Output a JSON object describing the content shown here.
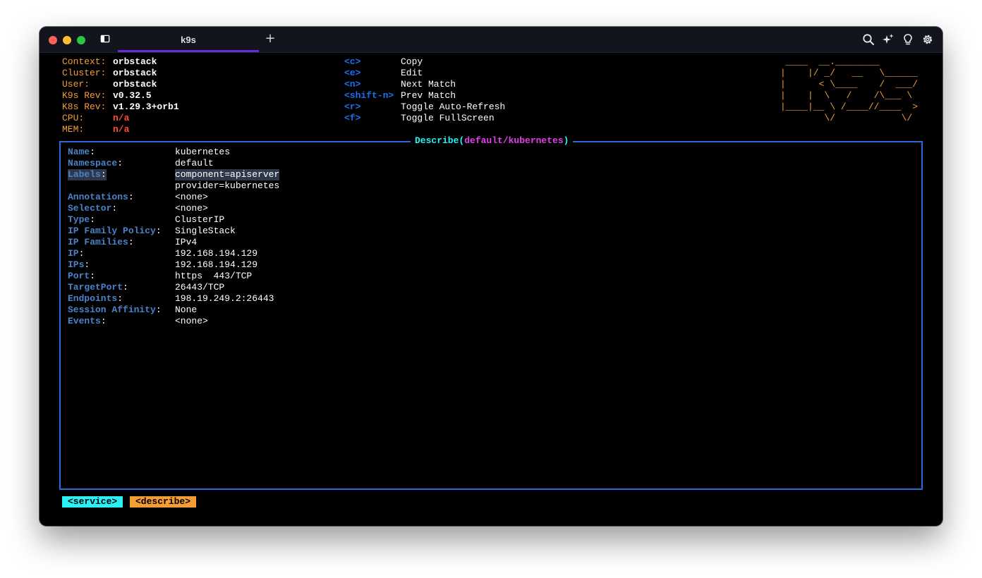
{
  "window": {
    "tab_title": "k9s",
    "new_tab_label": "+",
    "icons": [
      "sidebar-icon",
      "search-icon",
      "sparkle-icon",
      "lightbulb-icon",
      "gear-icon"
    ]
  },
  "header": {
    "info": [
      {
        "label": "Context:",
        "value": "orbstack"
      },
      {
        "label": "Cluster:",
        "value": "orbstack"
      },
      {
        "label": "User:",
        "value": "orbstack"
      },
      {
        "label": "K9s Rev:",
        "value": "v0.32.5"
      },
      {
        "label": "K8s Rev:",
        "value": "v1.29.3+orb1"
      },
      {
        "label": "CPU:",
        "value": "n/a"
      },
      {
        "label": "MEM:",
        "value": "n/a"
      }
    ],
    "shortcuts": [
      {
        "key": "<c>",
        "action": "Copy"
      },
      {
        "key": "<e>",
        "action": "Edit"
      },
      {
        "key": "<n>",
        "action": "Next Match"
      },
      {
        "key": "<shift-n>",
        "action": "Prev Match"
      },
      {
        "key": "<r>",
        "action": "Toggle Auto-Refresh"
      },
      {
        "key": "<f>",
        "action": "Toggle FullScreen"
      }
    ],
    "logo": " ____  __.________       \n|    |/ _/   __   \\______ \n|      < \\____    /  ___/ \n|    |  \\   /    /\\___ \\  \n|____|__ \\ /____//____  > \n        \\/            \\/  "
  },
  "describe": {
    "title_prefix": "Describe(",
    "title_resource": "default/kubernetes",
    "title_suffix": ")",
    "fields": [
      {
        "key": "Name",
        "value": "kubernetes"
      },
      {
        "key": "Namespace",
        "value": "default"
      },
      {
        "key": "Labels",
        "value": "component=apiserver"
      },
      {
        "key": "",
        "value": "provider=kubernetes"
      },
      {
        "key": "Annotations",
        "value": "<none>"
      },
      {
        "key": "Selector",
        "value": "<none>"
      },
      {
        "key": "Type",
        "value": "ClusterIP"
      },
      {
        "key": "IP Family Policy",
        "value": "SingleStack"
      },
      {
        "key": "IP Families",
        "value": "IPv4"
      },
      {
        "key": "IP",
        "value": "192.168.194.129"
      },
      {
        "key": "IPs",
        "value": "192.168.194.129"
      },
      {
        "key": "Port",
        "value": "https  443/TCP"
      },
      {
        "key": "TargetPort",
        "value": "26443/TCP"
      },
      {
        "key": "Endpoints",
        "value": "198.19.249.2:26443"
      },
      {
        "key": "Session Affinity",
        "value": "None"
      },
      {
        "key": "Events",
        "value": "<none>"
      }
    ],
    "colon": ":"
  },
  "breadcrumbs": [
    {
      "label": "<service>",
      "color": "#2af1f7"
    },
    {
      "label": "<describe>",
      "color": "#f59d35"
    }
  ],
  "colors": {
    "header_label": "#f59d35",
    "shortcut_key": "#1e6ff0",
    "field_key": "#4a83c9",
    "box_border": "#2a6bd8",
    "title_cyan": "#2af1f7",
    "title_magenta": "#e43ee8",
    "alert_red": "#ff4b33"
  }
}
